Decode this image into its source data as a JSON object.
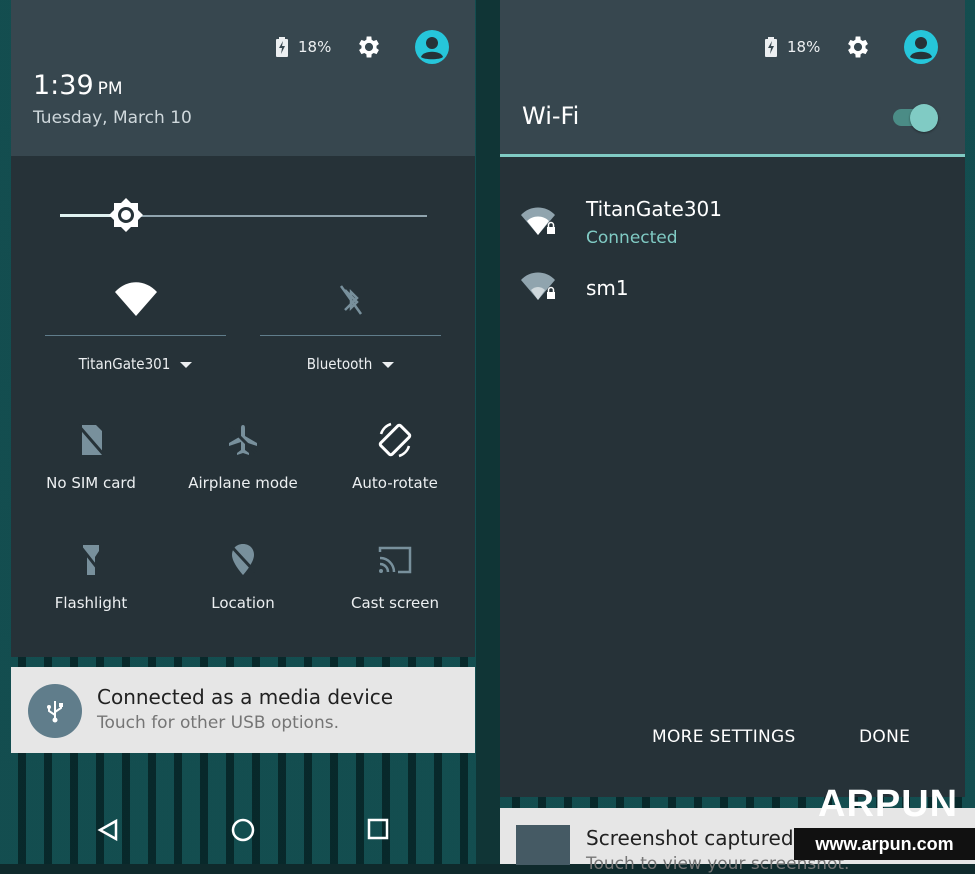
{
  "left_panel": {
    "status": {
      "battery": "18%"
    },
    "clock": {
      "time": "1:39",
      "ampm": "PM"
    },
    "date": "Tuesday, March 10",
    "brightness_level": 0.18,
    "wifi_tile": {
      "label": "TitanGate301"
    },
    "bluetooth_tile": {
      "label": "Bluetooth"
    },
    "tiles": [
      {
        "label": "No SIM card",
        "icon": "no-sim-icon"
      },
      {
        "label": "Airplane mode",
        "icon": "airplane-icon"
      },
      {
        "label": "Auto-rotate",
        "icon": "auto-rotate-icon"
      },
      {
        "label": "Flashlight",
        "icon": "flashlight-icon"
      },
      {
        "label": "Location",
        "icon": "location-off-icon"
      },
      {
        "label": "Cast screen",
        "icon": "cast-icon"
      }
    ],
    "usb_notification": {
      "title": "Connected as a media device",
      "subtitle": "Touch for other USB options."
    }
  },
  "right_panel": {
    "status": {
      "battery": "18%"
    },
    "title": "Wi-Fi",
    "wifi_enabled": true,
    "networks": [
      {
        "name": "TitanGate301",
        "status": "Connected",
        "secured": true
      },
      {
        "name": "sm1",
        "status": "",
        "secured": true
      }
    ],
    "more_settings_label": "MORE SETTINGS",
    "done_label": "DONE",
    "screenshot_notification": {
      "title": "Screenshot captured.",
      "subtitle": "Touch to view your screenshot."
    }
  },
  "watermark": {
    "logo": "ARPUN",
    "url": "www.arpun.com"
  },
  "colors": {
    "shade_bg": "#263238",
    "header_bg": "#37474f",
    "accent": "#80cbc4",
    "card_bg": "#e6e6e6"
  }
}
